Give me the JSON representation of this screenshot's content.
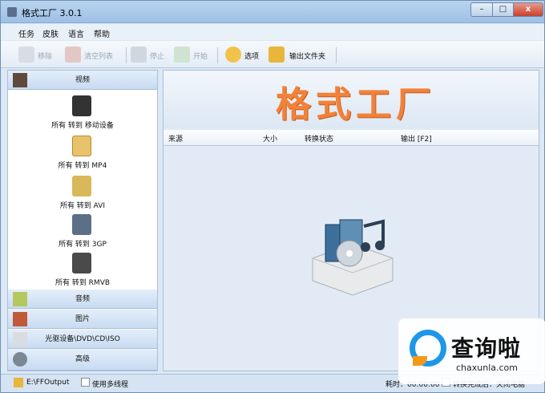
{
  "window": {
    "title": "格式工厂 3.0.1",
    "min": "–",
    "max": "□",
    "close": "x"
  },
  "menu": [
    "任务",
    "皮肤",
    "语言",
    "帮助"
  ],
  "toolbar": {
    "remove": "移除",
    "clear": "清空列表",
    "stop": "停止",
    "start": "开始",
    "options": "选项",
    "output_folder": "输出文件夹"
  },
  "sidebar": {
    "video": "视频",
    "video_items": [
      "所有 转到 移动设备",
      "所有 转到 MP4",
      "所有 转到 AVI",
      "所有 转到 3GP",
      "所有 转到 RMVB"
    ],
    "audio": "音频",
    "image": "图片",
    "rom": "光驱设备\\DVD\\CD\\ISO",
    "advanced": "高级"
  },
  "banner": "格式工厂",
  "table": {
    "source": "来源",
    "size": "大小",
    "status": "转换状态",
    "output": "输出 [F2]"
  },
  "status": {
    "path": "E:\\FFOutput",
    "multithread": "使用多线程",
    "elapsed": "耗时：00:00:00",
    "after": "转换完成后：关闭电脑"
  },
  "watermark": {
    "cn": "查询啦",
    "en": "chaxunla.com"
  }
}
